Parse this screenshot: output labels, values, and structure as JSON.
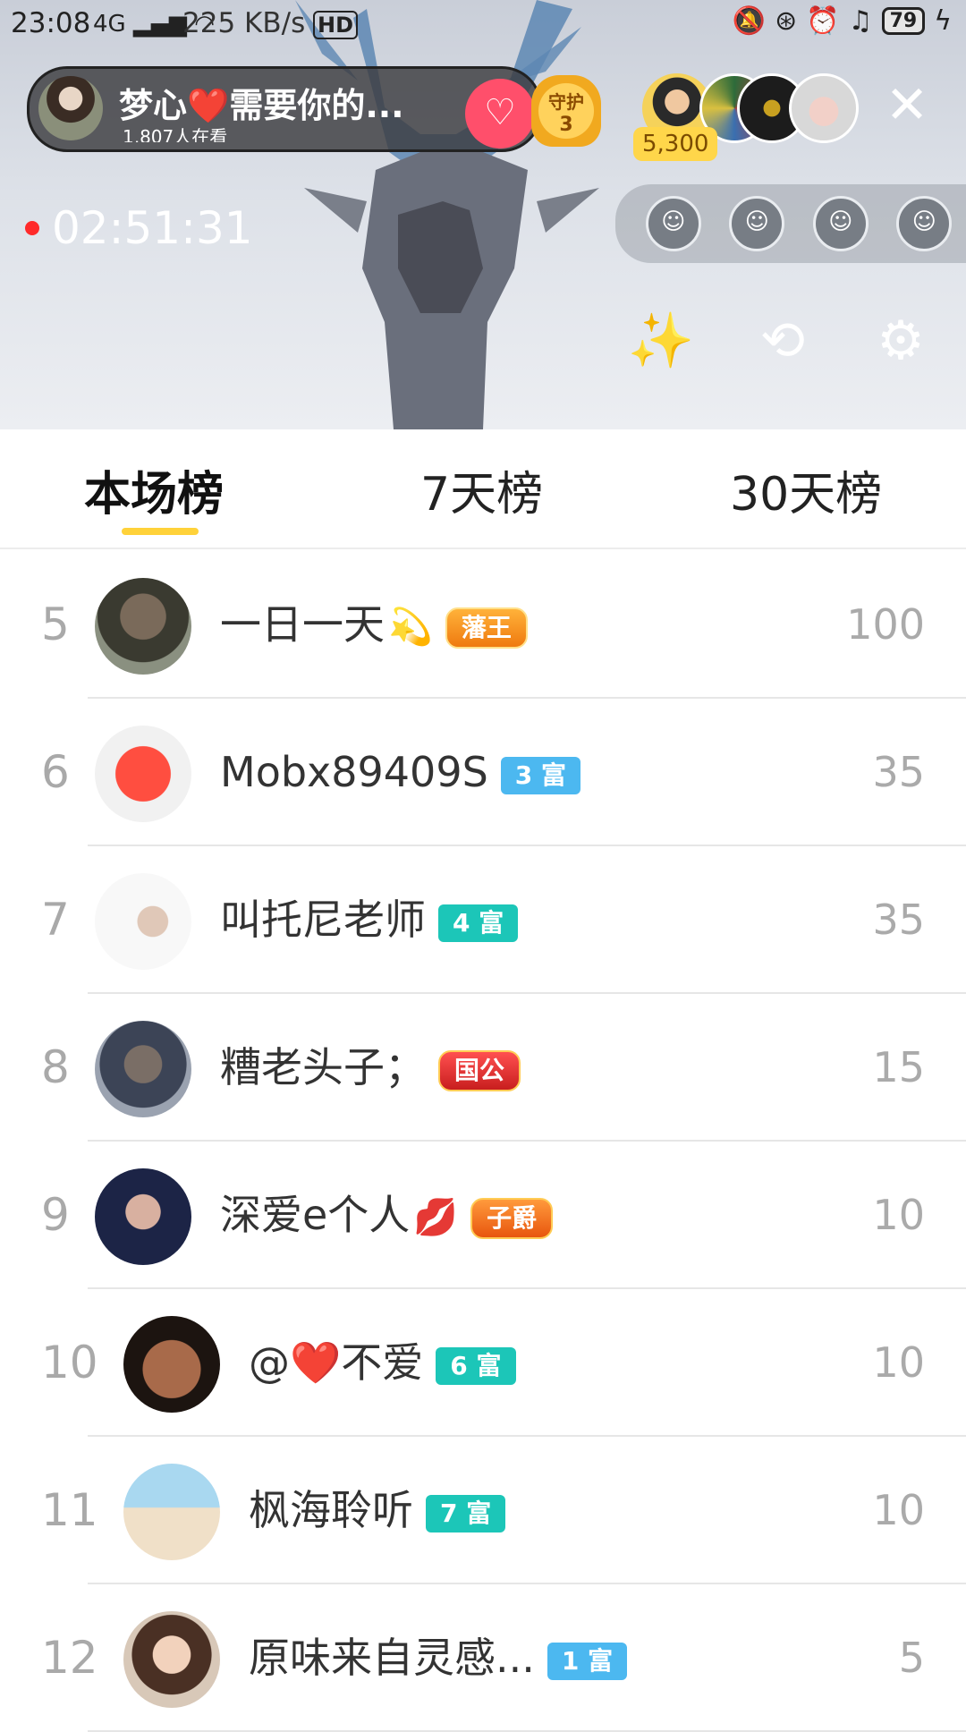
{
  "status_bar": {
    "time": "23:08",
    "signal": "4G",
    "speed": "225 KB/s",
    "hd": "HD",
    "battery": "79"
  },
  "live": {
    "host_name": "梦心❤️需要你的...",
    "viewers_text": "1,807人在看",
    "guard_label": "守护",
    "guard_count": "3",
    "coins": "5,300",
    "timer": "02:51:31",
    "accent_color": "#ffd23a"
  },
  "tabs": [
    {
      "label": "本场榜",
      "active": true
    },
    {
      "label": "7天榜",
      "active": false
    },
    {
      "label": "30天榜",
      "active": false
    }
  ],
  "rows": [
    {
      "rank": "5",
      "name": "一日一天",
      "emoji": "💫",
      "badge": "藩王",
      "badge_type": "noble-gold",
      "score": "100"
    },
    {
      "rank": "6",
      "name": "Mobx89409S",
      "emoji": "",
      "badge": "3 富",
      "badge_type": "fu-blue",
      "score": "35"
    },
    {
      "rank": "7",
      "name": "叫托尼老师",
      "emoji": "",
      "badge": "4 富",
      "badge_type": "fu",
      "score": "35"
    },
    {
      "rank": "8",
      "name": "糟老头子；",
      "emoji": "",
      "badge": "国公",
      "badge_type": "noble-red",
      "score": "15"
    },
    {
      "rank": "9",
      "name": "深爱e个人",
      "emoji": "💋",
      "badge": "子爵",
      "badge_type": "noble",
      "score": "10"
    },
    {
      "rank": "10",
      "name": "@❤️不爱",
      "emoji": "",
      "badge": "6 富",
      "badge_type": "fu",
      "score": "10"
    },
    {
      "rank": "11",
      "name": "枫海聆听",
      "emoji": "",
      "badge": "7 富",
      "badge_type": "fu",
      "score": "10"
    },
    {
      "rank": "12",
      "name": "原味来自灵感...",
      "emoji": "",
      "badge": "1 富",
      "badge_type": "fu-blue",
      "score": "5"
    }
  ]
}
